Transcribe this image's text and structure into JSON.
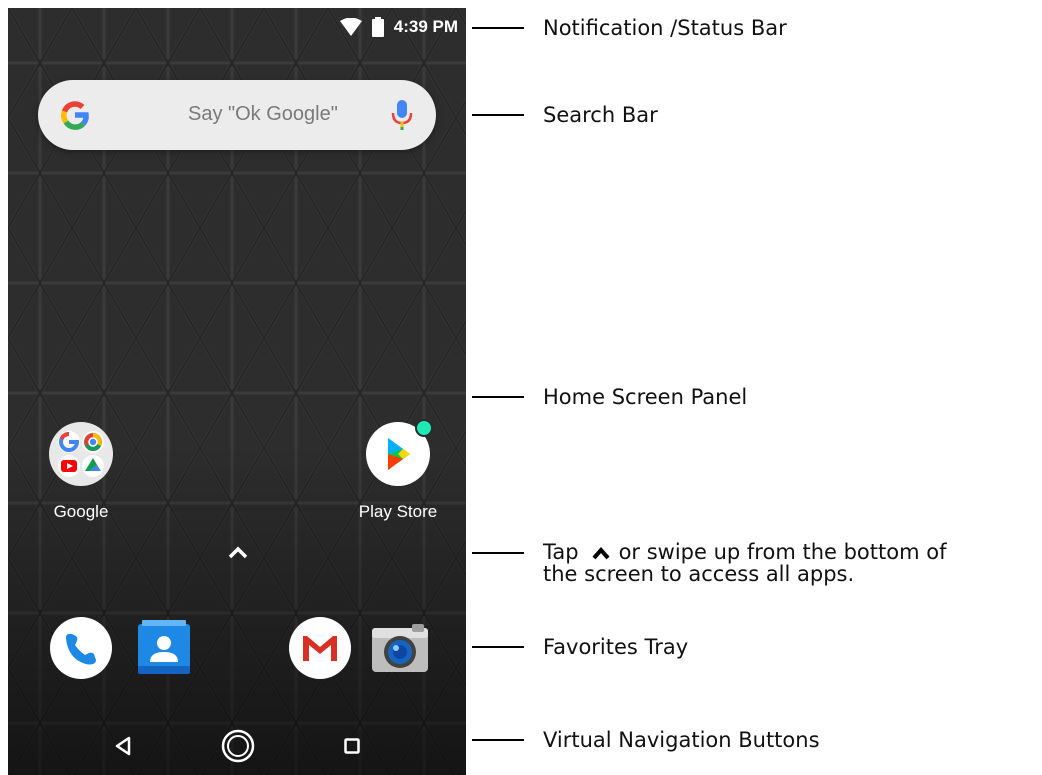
{
  "status_bar": {
    "time": "4:39 PM"
  },
  "search_bar": {
    "placeholder": "Say \"Ok Google\""
  },
  "home_apps": [
    {
      "label": "Google"
    },
    {
      "label": "Play Store"
    }
  ],
  "favorites": [
    "phone-icon",
    "contacts-icon",
    "gmail-icon",
    "camera-icon"
  ],
  "callouts": {
    "status": "Notification /Status Bar",
    "search": "Search Bar",
    "home": "Home Screen Panel",
    "tap_prefix": "Tap",
    "tap_suffix": "or swipe up from the bottom of",
    "tap_line2": "the screen to access all apps.",
    "favorites": "Favorites Tray",
    "nav": "Virtual Navigation Buttons"
  },
  "colors": {
    "wallpaper": "#2b2b2b",
    "play_badge": "#1de9b6",
    "gmail_red": "#d93025",
    "contacts_blue": "#1e88e5"
  }
}
